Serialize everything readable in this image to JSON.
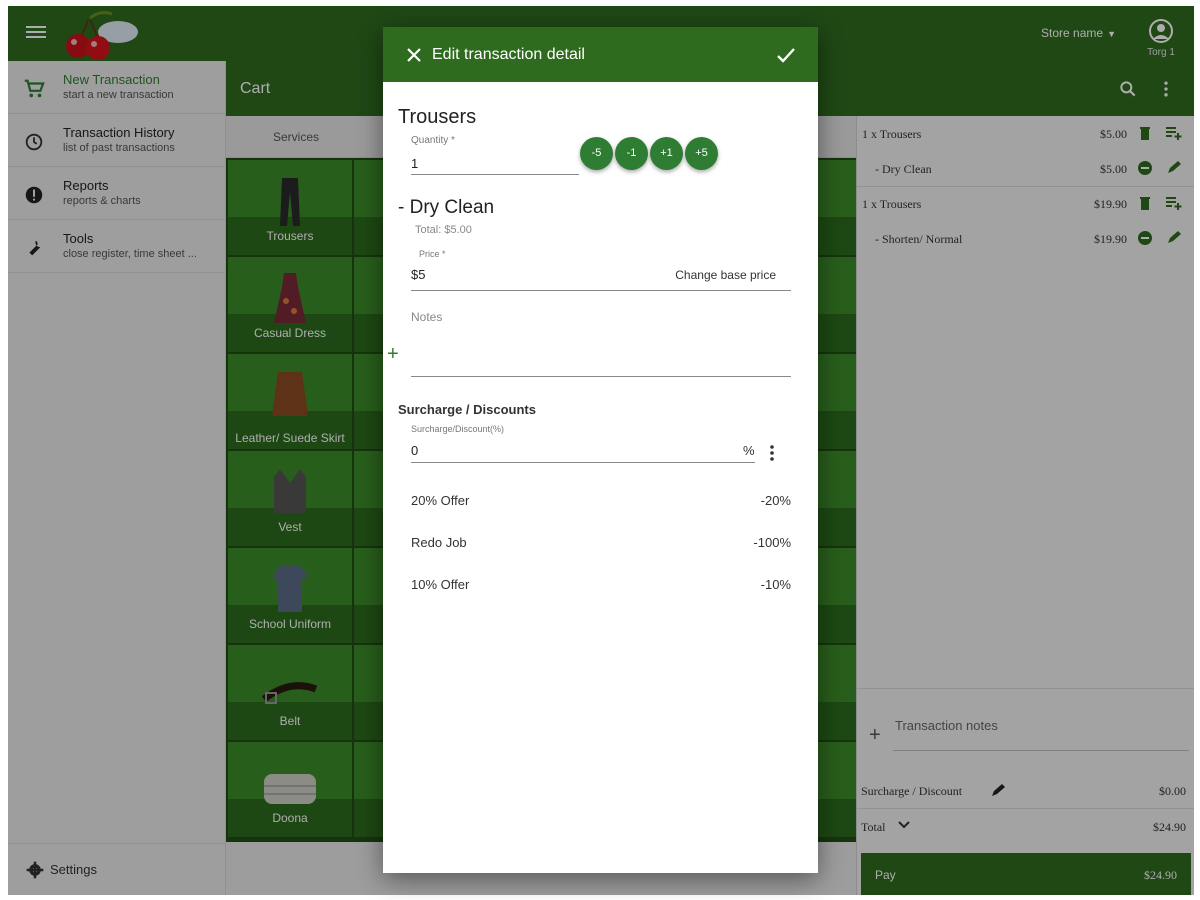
{
  "colors": {
    "primary": "#2e6b1f",
    "accent": "#2e7d32",
    "tile": "#3c8b28"
  },
  "header": {
    "store_name": "Store name",
    "user_label": "Torg 1"
  },
  "nav": {
    "items": [
      {
        "title": "New Transaction",
        "subtitle": "start a new transaction",
        "icon": "cart-icon"
      },
      {
        "title": "Transaction History",
        "subtitle": "list of past transactions",
        "icon": "history-icon"
      },
      {
        "title": "Reports",
        "subtitle": "reports & charts",
        "icon": "alert-circle-icon"
      },
      {
        "title": "Tools",
        "subtitle": "close register, time sheet ...",
        "icon": "wrench-icon"
      }
    ],
    "settings": "Settings"
  },
  "cart": {
    "title": "Cart",
    "tab": "Services",
    "tiles": [
      {
        "label": "Trousers",
        "icon": "trousers-icon"
      },
      {
        "label": "Casual Dress",
        "icon": "dress-icon"
      },
      {
        "label": "Leather/ Suede Skirt",
        "icon": "skirt-icon"
      },
      {
        "label": "Vest",
        "icon": "vest-icon"
      },
      {
        "label": "School Uniform",
        "icon": "uniform-icon"
      },
      {
        "label": "Belt",
        "icon": "belt-icon"
      },
      {
        "label": "Doona",
        "icon": "doona-icon"
      }
    ]
  },
  "summary": {
    "rows": [
      {
        "name": "1 x Trousers",
        "price": "$5.00",
        "kind": "item"
      },
      {
        "name": "- Dry Clean",
        "price": "$5.00",
        "kind": "service"
      },
      {
        "name": "1 x Trousers",
        "price": "$19.90",
        "kind": "item"
      },
      {
        "name": "- Shorten/ Normal",
        "price": "$19.90",
        "kind": "service"
      }
    ],
    "transaction_notes": "Transaction notes",
    "surcharge_label": "Surcharge / Discount",
    "surcharge_value": "$0.00",
    "total_label": "Total",
    "total_value": "$24.90",
    "pay_label": "Pay",
    "pay_amount": "$24.90"
  },
  "dialog": {
    "title": "Edit transaction detail",
    "item_name": "Trousers",
    "quantity_label": "Quantity *",
    "quantity_value": "1",
    "steps": [
      "-5",
      "-1",
      "+1",
      "+5"
    ],
    "service_name": "- Dry Clean",
    "service_total": "Total: $5.00",
    "price_label": "Price *",
    "price_value": "$5",
    "change_base_price": "Change base price",
    "notes_label": "Notes",
    "surcharge_heading": "Surcharge / Discounts",
    "percent_label": "Surcharge/Discount(%)",
    "percent_value": "0",
    "percent_sign": "%",
    "offers": [
      {
        "name": "20% Offer",
        "value": "-20%"
      },
      {
        "name": "Redo Job",
        "value": "-100%"
      },
      {
        "name": "10% Offer",
        "value": "-10%"
      }
    ]
  }
}
